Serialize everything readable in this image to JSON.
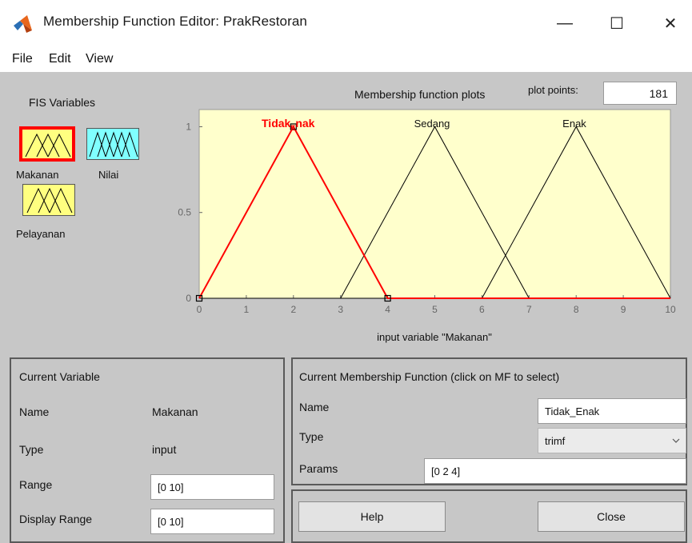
{
  "window": {
    "title": "Membership Function Editor: PrakRestoran",
    "minimize_glyph": "—",
    "maximize_glyph": "☐",
    "close_glyph": "✕"
  },
  "menu": [
    "File",
    "Edit",
    "View"
  ],
  "fis_variables": {
    "heading": "FIS Variables",
    "items": [
      {
        "label": "Makanan",
        "selected": true,
        "kind": "input"
      },
      {
        "label": "Nilai",
        "selected": false,
        "kind": "output"
      },
      {
        "label": "Pelayanan",
        "selected": false,
        "kind": "input"
      }
    ]
  },
  "plot": {
    "title": "Membership function plots",
    "plot_points_label": "plot points:",
    "plot_points": "181",
    "xlabel": "input variable \"Makanan\"",
    "mf_labels": {
      "tidak_base": "Tidak",
      "tidak_sub": "E",
      "tidak_rest": "nak",
      "sedang": "Sedang",
      "enak": "Enak"
    },
    "ytick_labels": [
      "0",
      "0.5",
      "1"
    ],
    "xtick_labels": [
      "0",
      "1",
      "2",
      "3",
      "4",
      "5",
      "6",
      "7",
      "8",
      "9",
      "10"
    ]
  },
  "chart_data": {
    "type": "line",
    "xlim": [
      0,
      10
    ],
    "ylim": [
      0,
      1.1
    ],
    "series": [
      {
        "name": "Tidak_Enak",
        "x": [
          0,
          2,
          4,
          10
        ],
        "y": [
          0,
          1,
          0,
          0
        ],
        "selected": true
      },
      {
        "name": "Sedang",
        "x": [
          3,
          5,
          7
        ],
        "y": [
          0,
          1,
          0
        ],
        "selected": false
      },
      {
        "name": "Enak",
        "x": [
          6,
          8,
          10
        ],
        "y": [
          0,
          1,
          0
        ],
        "selected": false
      }
    ]
  },
  "current_variable": {
    "heading": "Current Variable",
    "name_label": "Name",
    "name_value": "Makanan",
    "type_label": "Type",
    "type_value": "input",
    "range_label": "Range",
    "range_value": "[0 10]",
    "display_range_label": "Display Range",
    "display_range_value": "[0 10]"
  },
  "current_mf": {
    "heading": "Current Membership Function (click on MF to select)",
    "name_label": "Name",
    "name_value": "Tidak_Enak",
    "type_label": "Type",
    "type_value": "trimf",
    "params_label": "Params",
    "params_value": "[0 2 4]"
  },
  "buttons": {
    "help": "Help",
    "close": "Close"
  },
  "colors": {
    "plot_bg": "#ffffcc",
    "selected_mf": "#ff0000",
    "mf_line": "#000000",
    "panel_bg": "#c7c7c7",
    "icon_yellow": "#ffff80",
    "icon_cyan": "#80ffff"
  }
}
